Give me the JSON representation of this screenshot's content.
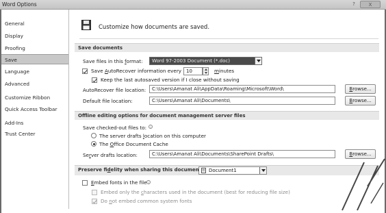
{
  "window": {
    "title": "Word Options",
    "help": "?",
    "close": "X"
  },
  "nav": {
    "items": [
      {
        "label": "General"
      },
      {
        "label": "Display"
      },
      {
        "label": "Proofing"
      },
      {
        "label": "Save",
        "selected": true
      },
      {
        "label": "Language"
      },
      {
        "label": "Advanced"
      },
      {
        "label": "Customize Ribbon"
      },
      {
        "label": "Quick Access Toolbar"
      },
      {
        "label": "Add-Ins"
      },
      {
        "label": "Trust Center"
      }
    ]
  },
  "header": {
    "text": "Customize how documents are saved.",
    "icon": "floppy-disk-icon"
  },
  "save_documents": {
    "section": "Save documents",
    "format_label_pre": "Save files in this ",
    "format_label_u": "f",
    "format_label_post": "ormat:",
    "format_value": "Word 97-2003 Document (*.doc)",
    "autorecover_pre": "Save ",
    "autorecover_u": "A",
    "autorecover_post": "utoRecover information every",
    "autorecover_checked": true,
    "autorecover_minutes": "10",
    "minutes_u": "m",
    "minutes_post": "inutes",
    "keep_last": "Keep the last autosaved version if I close without saving",
    "keep_last_checked": true,
    "autorecover_loc_pre": "AutoRecover file location:",
    "autorecover_loc_value": "C:\\Users\\Amanat Ali\\AppData\\Roaming\\Microsoft\\Word\\",
    "default_loc_pre": "Default f",
    "default_loc_u": "i",
    "default_loc_post": "le location:",
    "default_loc_value": "C:\\Users\\Amanat Ali\\Documents\\",
    "browse_u": "B",
    "browse_post": "rowse..."
  },
  "offline": {
    "section": "Offline editing options for document management server files",
    "checked_out_label": "Save checked-out files to:",
    "option_server_pre": "The server drafts ",
    "option_server_u": "l",
    "option_server_post": "ocation on this computer",
    "option_server_selected": false,
    "option_cache_pre": "The ",
    "option_cache_u": "O",
    "option_cache_post": "ffice Document Cache",
    "option_cache_selected": true,
    "server_drafts_pre": "Se",
    "server_drafts_u": "r",
    "server_drafts_post": "ver drafts location:",
    "server_drafts_value": "C:\\Users\\Amanat Ali\\Documents\\SharePoint Drafts\\"
  },
  "fidelity": {
    "section_pre": "Preserve fi",
    "section_u": "d",
    "section_post": "elity when sharing this document:",
    "document_value": "Document1",
    "document_icon": "document-icon",
    "embed_fonts_pre": "",
    "embed_fonts_u": "E",
    "embed_fonts_post": "mbed fonts in the file",
    "embed_fonts_checked": false,
    "embed_only_pre": "Embed only the ",
    "embed_only_u": "c",
    "embed_only_post": "haracters used in the document (best for reducing file size)",
    "embed_only_checked": false,
    "no_common_pre": "Do ",
    "no_common_u": "n",
    "no_common_post": "ot embed common system fonts",
    "no_common_checked": true
  }
}
